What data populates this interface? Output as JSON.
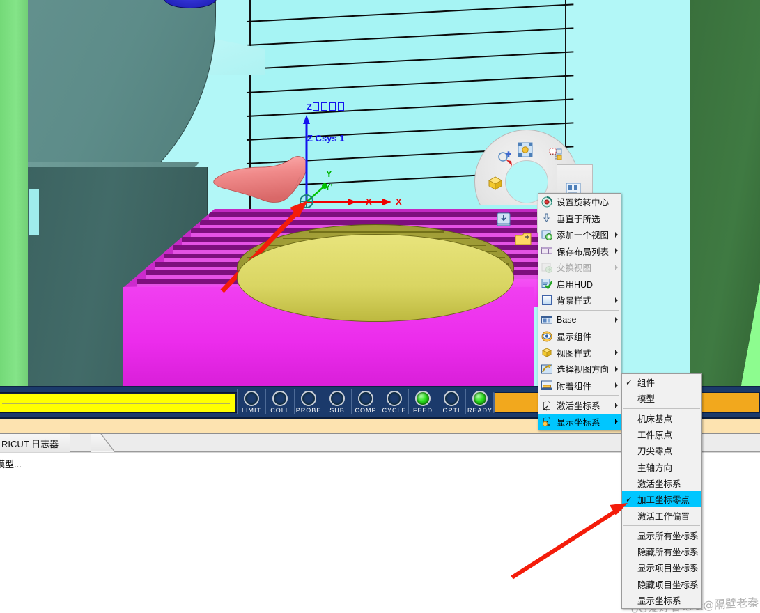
{
  "viewport": {
    "csys_labels": {
      "z_top": "Z",
      "z_top_tofu_count": 4,
      "z_csys": "Z Csys 1",
      "y_prime": "Y'",
      "y": "Y",
      "x_prime": "X",
      "x": "X"
    },
    "pie_menu": {
      "name": "view-manipulator",
      "icons": [
        "pan-icon",
        "zoom-region-icon",
        "fit-icon",
        "view-cube-icon",
        "save-view-icon",
        "restore-view-icon",
        "layout-icon"
      ]
    },
    "colors": {
      "background": "#b2f7f7",
      "wall_green_light": "#84e488",
      "wall_green_dark": "#3f7a42",
      "enclosure_teal": "#5d8c89",
      "table_magenta": "#ec2cec",
      "rotary_olive": "#9a9733",
      "rotary_gold": "#d9d562",
      "shoe_pink": "#ef8f8f",
      "annotation_red": "#f41c0a"
    }
  },
  "statusbar": {
    "progress_value": "",
    "progress_color": "#ffff00",
    "amber_color": "#f2a81d",
    "lamps": [
      {
        "label": "LIMIT",
        "on": false
      },
      {
        "label": "COLL",
        "on": false
      },
      {
        "label": "PROBE",
        "on": false
      },
      {
        "label": "SUB",
        "on": false
      },
      {
        "label": "COMP",
        "on": false
      },
      {
        "label": "CYCLE",
        "on": false
      },
      {
        "label": "FEED",
        "on": true
      },
      {
        "label": "OPTI",
        "on": false
      },
      {
        "label": "READY",
        "on": true
      }
    ]
  },
  "bottom_panel": {
    "tab_label": "RICUT 日志器",
    "log_line": "模型..."
  },
  "context_menu": {
    "items": [
      {
        "label": "设置旋转中心",
        "icon": "rotation-center-icon",
        "submenu": false,
        "disabled": false,
        "separator_after": false
      },
      {
        "label": "垂直于所选",
        "icon": "normal-to-icon",
        "submenu": false,
        "disabled": false,
        "separator_after": false
      },
      {
        "label": "添加一个视图",
        "icon": "add-view-icon",
        "submenu": true,
        "disabled": false,
        "separator_after": false
      },
      {
        "label": "保存布局列表",
        "icon": "save-layout-icon",
        "submenu": true,
        "disabled": false,
        "separator_after": false
      },
      {
        "label": "交换视图",
        "icon": "swap-view-icon",
        "submenu": true,
        "disabled": true,
        "separator_after": false
      },
      {
        "label": "启用HUD",
        "icon": "hud-icon",
        "submenu": false,
        "disabled": false,
        "separator_after": false
      },
      {
        "label": "背景样式",
        "icon": "background-icon",
        "submenu": true,
        "disabled": false,
        "separator_after": true
      },
      {
        "label": "Base",
        "icon": "base-icon",
        "submenu": true,
        "disabled": false,
        "separator_after": false
      },
      {
        "label": "显示组件",
        "icon": "show-component-icon",
        "submenu": false,
        "disabled": false,
        "separator_after": false
      },
      {
        "label": "视图样式",
        "icon": "view-style-icon",
        "submenu": true,
        "disabled": false,
        "separator_after": false
      },
      {
        "label": "选择视图方向",
        "icon": "view-direction-icon",
        "submenu": true,
        "disabled": false,
        "separator_after": false
      },
      {
        "label": "附着组件",
        "icon": "attach-component-icon",
        "submenu": true,
        "disabled": false,
        "separator_after": true
      },
      {
        "label": "激活坐标系",
        "icon": "active-csys-icon",
        "submenu": true,
        "disabled": false,
        "separator_after": false
      },
      {
        "label": "显示坐标系",
        "icon": "show-csys-icon",
        "submenu": true,
        "disabled": false,
        "separator_after": false,
        "selected": true
      }
    ]
  },
  "submenu": {
    "items": [
      {
        "label": "组件",
        "checked": true,
        "selected": false,
        "separator_after": false
      },
      {
        "label": "模型",
        "checked": false,
        "selected": false,
        "separator_after": true
      },
      {
        "label": "机床基点",
        "checked": false,
        "selected": false,
        "separator_after": false
      },
      {
        "label": "工件原点",
        "checked": false,
        "selected": false,
        "separator_after": false
      },
      {
        "label": "刀尖零点",
        "checked": false,
        "selected": false,
        "separator_after": false
      },
      {
        "label": "主轴方向",
        "checked": false,
        "selected": false,
        "separator_after": false
      },
      {
        "label": "激活坐标系",
        "checked": false,
        "selected": false,
        "separator_after": false
      },
      {
        "label": "加工坐标零点",
        "checked": true,
        "selected": true,
        "separator_after": false
      },
      {
        "label": "激活工作偏置",
        "checked": false,
        "selected": false,
        "separator_after": true
      },
      {
        "label": "显示所有坐标系",
        "checked": false,
        "selected": false,
        "separator_after": false
      },
      {
        "label": "隐藏所有坐标系",
        "checked": false,
        "selected": false,
        "separator_after": false
      },
      {
        "label": "显示项目坐标系",
        "checked": false,
        "selected": false,
        "separator_after": false
      },
      {
        "label": "隐藏项目坐标系",
        "checked": false,
        "selected": false,
        "separator_after": false
      },
      {
        "label": "显示坐标系",
        "checked": false,
        "selected": false,
        "separator_after": false
      }
    ]
  },
  "watermark": {
    "text": "UG爱好者论坛@隔壁老秦"
  }
}
